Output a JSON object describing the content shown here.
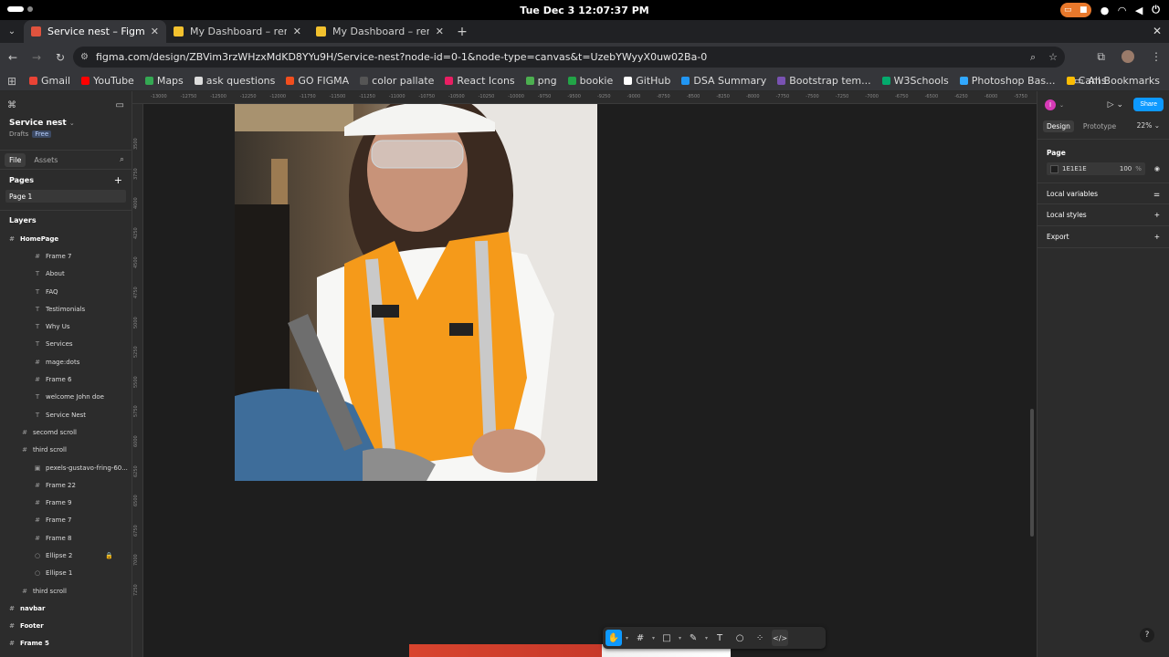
{
  "os": {
    "clock": "Tue Dec 3  12:07:37 PM"
  },
  "browser": {
    "tabs": [
      {
        "title": "Service nest – Figma",
        "active": true,
        "favicon_color": "#e0533e"
      },
      {
        "title": "My Dashboard – remove...",
        "active": false,
        "favicon_color": "#f2c12e"
      },
      {
        "title": "My Dashboard – remove...",
        "active": false,
        "favicon_color": "#f2c12e"
      }
    ],
    "url": "figma.com/design/ZBVim3rzWHzxMdKD8YYu9H/Service-nest?node-id=0-1&node-type=canvas&t=UzebYWyyX0uw02Ba-0",
    "bookmarks": [
      {
        "label": "Gmail",
        "color": "#ea4335"
      },
      {
        "label": "YouTube",
        "color": "#ff0000"
      },
      {
        "label": "Maps",
        "color": "#34a853"
      },
      {
        "label": "ask questions",
        "color": "#dddddd"
      },
      {
        "label": "GO FIGMA",
        "color": "#f24e1e"
      },
      {
        "label": "color pallate",
        "color": "#555555"
      },
      {
        "label": "React Icons",
        "color": "#e91e63"
      },
      {
        "label": "png",
        "color": "#4caf50"
      },
      {
        "label": "bookie",
        "color": "#22a447"
      },
      {
        "label": "GitHub",
        "color": "#ffffff"
      },
      {
        "label": "DSA Summary",
        "color": "#2196f3"
      },
      {
        "label": "Bootstrap tem...",
        "color": "#7952b3"
      },
      {
        "label": "W3Schools",
        "color": "#04aa6d"
      },
      {
        "label": "Photoshop Bas...",
        "color": "#31a8ff"
      },
      {
        "label": "Cams",
        "color": "#fbbc04"
      }
    ],
    "all_bookmarks": "All Bookmarks"
  },
  "figma": {
    "file_name": "Service nest",
    "drafts": "Drafts",
    "plan_badge": "Free",
    "left_tabs": {
      "file": "File",
      "assets": "Assets"
    },
    "pages_label": "Pages",
    "current_page": "Page 1",
    "layers_label": "Layers",
    "layers": [
      {
        "name": "HomePage",
        "icon": "#",
        "level": 0,
        "bold": true
      },
      {
        "name": "Frame 7",
        "icon": "#",
        "level": 2
      },
      {
        "name": "About",
        "icon": "T",
        "level": 2
      },
      {
        "name": "FAQ",
        "icon": "T",
        "level": 2
      },
      {
        "name": "Testimonials",
        "icon": "T",
        "level": 2
      },
      {
        "name": "Why Us",
        "icon": "T",
        "level": 2
      },
      {
        "name": "Services",
        "icon": "T",
        "level": 2
      },
      {
        "name": "mage:dots",
        "icon": "#",
        "level": 2
      },
      {
        "name": "Frame 6",
        "icon": "#",
        "level": 2
      },
      {
        "name": "welcome John doe",
        "icon": "T",
        "level": 2
      },
      {
        "name": "Service Nest",
        "icon": "T",
        "level": 2
      },
      {
        "name": "secomd scroll",
        "icon": "#",
        "level": 1
      },
      {
        "name": "third scroll",
        "icon": "#",
        "level": 1
      },
      {
        "name": "pexels-gustavo-fring-60...",
        "icon": "▣",
        "level": 2
      },
      {
        "name": "Frame 22",
        "icon": "#",
        "level": 2
      },
      {
        "name": "Frame 9",
        "icon": "#",
        "level": 2
      },
      {
        "name": "Frame 7",
        "icon": "#",
        "level": 2
      },
      {
        "name": "Frame 8",
        "icon": "#",
        "level": 2
      },
      {
        "name": "Ellipse 2",
        "icon": "○",
        "level": 2,
        "locked": true
      },
      {
        "name": "Ellipse 1",
        "icon": "○",
        "level": 2
      },
      {
        "name": "third scroll",
        "icon": "#",
        "level": 1
      },
      {
        "name": "navbar",
        "icon": "#",
        "level": 0,
        "bold": true
      },
      {
        "name": "Footer",
        "icon": "#",
        "level": 0,
        "bold": true
      },
      {
        "name": "Frame 5",
        "icon": "#",
        "level": 0,
        "bold": true
      }
    ],
    "ruler_top": [
      "-13000",
      "-12750",
      "-12500",
      "-12250",
      "-12000",
      "-11750",
      "-11500",
      "-11250",
      "-11000",
      "-10750",
      "-10500",
      "-10250",
      "-10000",
      "-9750",
      "-9500",
      "-9250",
      "-9000",
      "-8750",
      "-8500",
      "-8250",
      "-8000",
      "-7750",
      "-7500",
      "-7250",
      "-7000",
      "-6750",
      "-6500",
      "-6250",
      "-6000",
      "-5750"
    ],
    "ruler_left": [
      "3500",
      "3750",
      "4000",
      "4250",
      "4500",
      "4750",
      "5000",
      "5250",
      "5500",
      "5750",
      "6000",
      "6250",
      "6500",
      "6750",
      "7000",
      "7250"
    ],
    "right": {
      "user_initial": "I",
      "share": "Share",
      "tabs": {
        "design": "Design",
        "prototype": "Prototype"
      },
      "zoom": "22%",
      "page_label": "Page",
      "bg_color": "1E1E1E",
      "bg_opacity": "100",
      "pct_sign": "%",
      "sections": [
        "Local variables",
        "Local styles",
        "Export"
      ],
      "help": "?"
    }
  }
}
